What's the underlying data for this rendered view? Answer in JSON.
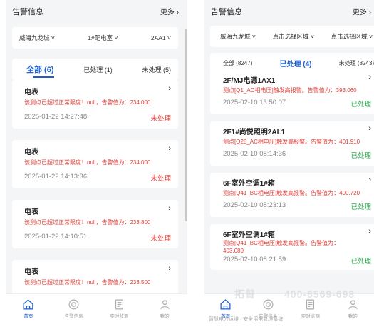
{
  "left": {
    "header": {
      "title": "告警信息",
      "more": "更多 ›"
    },
    "filters": [
      "威海九龙城 ˅",
      "1#配电室 ˅",
      "2AA1 ˅"
    ],
    "tabs": [
      "全部 (6)",
      "已处理 (1)",
      "未处理 (5)"
    ],
    "alarms": [
      {
        "title": "电表",
        "message": "该测点已超过正常限度！null，告警值为：234.000",
        "time": "2025-01-22 14:27:48",
        "status": "未处理"
      },
      {
        "title": "电表",
        "message": "该测点已超过正常限度！null，告警值为：234.000",
        "time": "2025-01-22 14:13:36",
        "status": "未处理"
      },
      {
        "title": "电表",
        "message": "该测点已超过正常限度！null，告警值为：233.800",
        "time": "2025-01-22 14:10:51",
        "status": "未处理"
      },
      {
        "title": "电表",
        "message": "该测点已超过正常限度！null，告警值为：233.500",
        "time": "",
        "status": ""
      }
    ],
    "nav": [
      "首页",
      "告警信息",
      "实时监测",
      "我的"
    ]
  },
  "right": {
    "header": {
      "title": "告警信息",
      "more": "更多 ›"
    },
    "filters": [
      "威海九龙城 ˅",
      "点击选择区域 ˅",
      "点击选择区域 ˅"
    ],
    "tabs": [
      "全部 (8247)",
      "已处理 (4)",
      "未处理 (8243)"
    ],
    "alarms": [
      {
        "title": "2F/MJ电源1AX1",
        "message": "测点[Q1_AC相电压]触发高报警。告警值为：393.060",
        "time": "2025-02-10 13:50:07",
        "status": "已处理"
      },
      {
        "title": "2F1#尚悦照明2AL1",
        "message": "测点[Q28_AC相电压]触发高报警。告警值为：401.910",
        "time": "2025-02-10 08:14:36",
        "status": "已处理"
      },
      {
        "title": "6F室外空调1#箱",
        "message": "测点[Q41_BC相电压]触发高报警。告警值为：400.720",
        "time": "2025-02-10 08:23:13",
        "status": "已处理"
      },
      {
        "title": "6F室外空调1#箱",
        "message": "测点[Q41_BC相电压]触发高报警。告警值为：403.080",
        "time": "2025-02-10 08:21:59",
        "status": "已处理"
      }
    ],
    "nav": [
      "首页",
      "告警信息",
      "实时监测",
      "我的"
    ],
    "watermark": {
      "brand": "拓普",
      "phone": "400-6569-698",
      "footer": "智慧电力运维 · 安全用电管理系统"
    }
  },
  "colors": {
    "accent": "#1f5fcc",
    "alarm": "#e2403a",
    "handled": "#2aa84a"
  }
}
